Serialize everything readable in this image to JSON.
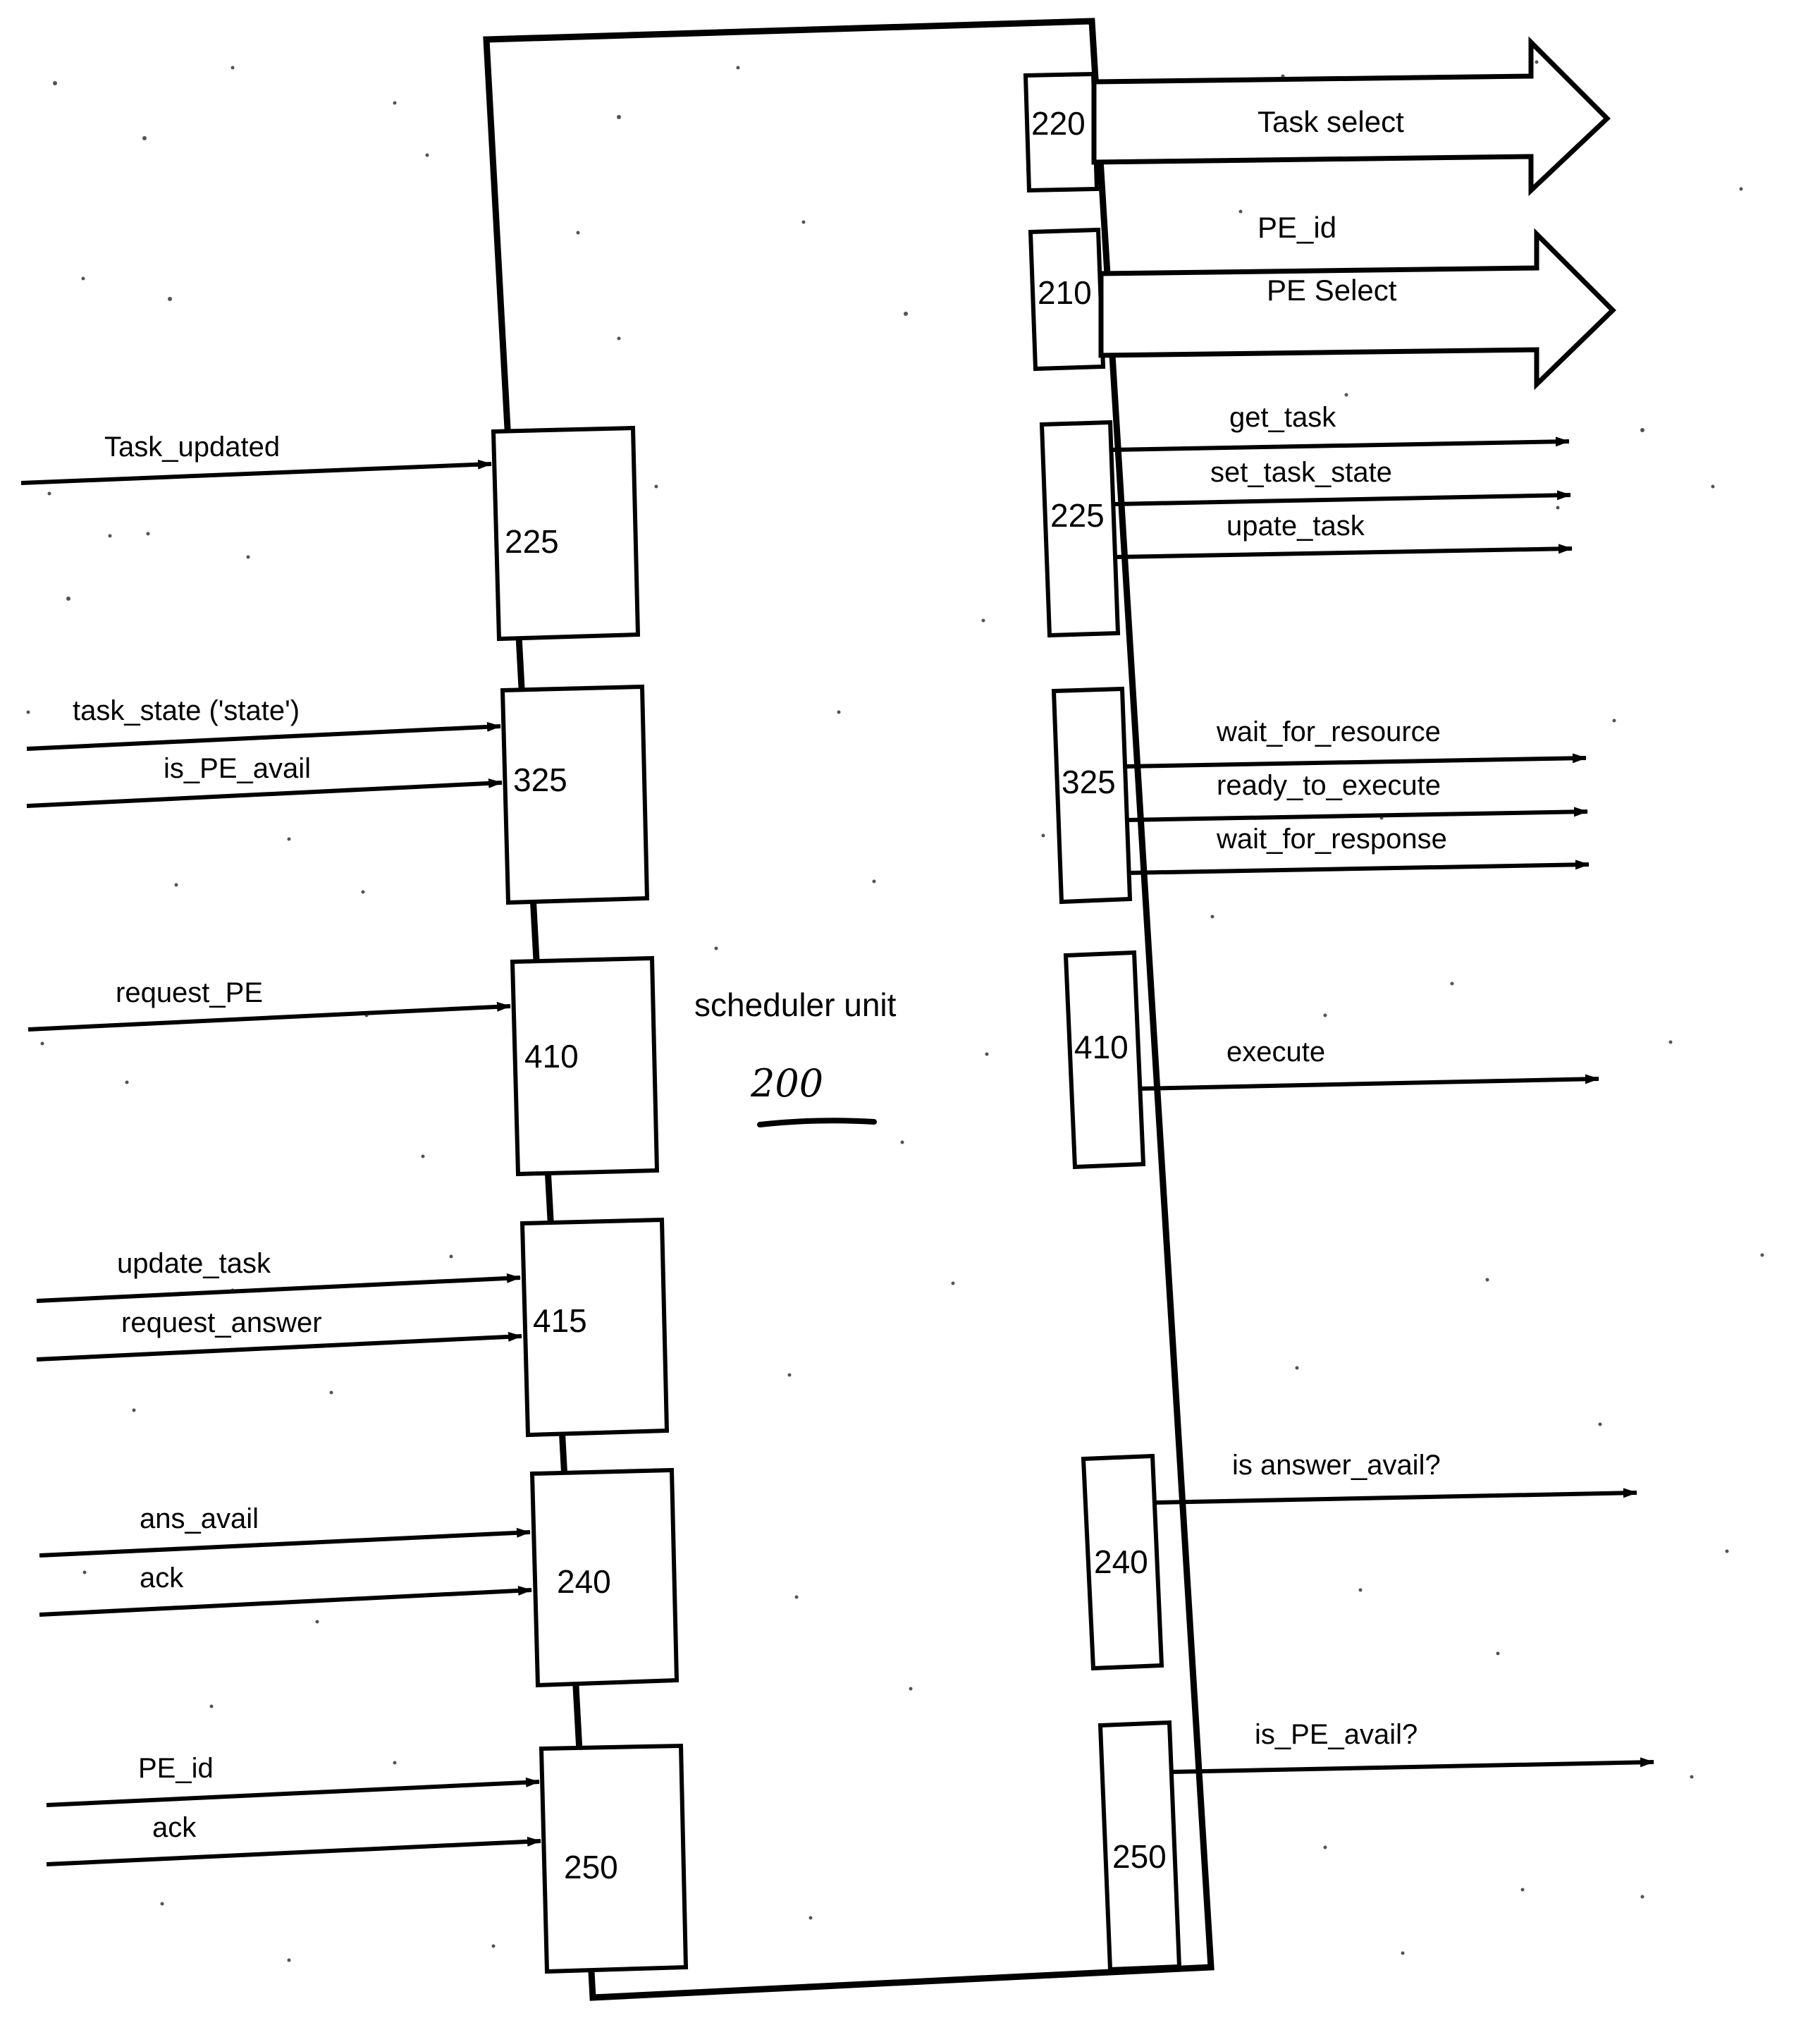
{
  "diagram": {
    "title": "scheduler unit",
    "reference_number": "200",
    "ink_color": "#000000",
    "background_color": "#ffffff"
  },
  "unit": {
    "label": "scheduler unit",
    "number": "200"
  },
  "left_ports": [
    {
      "number": "225",
      "signals": [
        "Task_updated"
      ]
    },
    {
      "number": "325",
      "signals": [
        "task_state ('state')",
        "is_PE_avail"
      ]
    },
    {
      "number": "410",
      "signals": [
        "request_PE"
      ]
    },
    {
      "number": "415",
      "signals": [
        "update_task",
        "request_answer"
      ]
    },
    {
      "number": "240",
      "signals": [
        "ans_avail",
        "ack"
      ]
    },
    {
      "number": "250",
      "signals": [
        "PE_id",
        "ack"
      ]
    }
  ],
  "right_ports": [
    {
      "number": "220",
      "style": "block-arrow",
      "inner_label": "Task select",
      "above_label": "",
      "signals": []
    },
    {
      "number": "210",
      "style": "block-arrow",
      "inner_label": "PE Select",
      "above_label": "PE_id",
      "signals": []
    },
    {
      "number": "225",
      "style": "line-arrows",
      "signals": [
        "get_task",
        "set_task_state",
        "upate_task"
      ]
    },
    {
      "number": "325",
      "style": "line-arrows",
      "signals": [
        "wait_for_resource",
        "ready_to_execute",
        "wait_for_response"
      ]
    },
    {
      "number": "410",
      "style": "line-arrows",
      "signals": [
        "execute"
      ]
    },
    {
      "number": "240",
      "style": "line-arrows",
      "signals": [
        "is answer_avail?"
      ]
    },
    {
      "number": "250",
      "style": "line-arrows",
      "signals": [
        "is_PE_avail?"
      ]
    }
  ],
  "text": {
    "task_updated": "Task_updated",
    "task_state": "task_state ('state')",
    "is_PE_avail_in": "is_PE_avail",
    "request_PE": "request_PE",
    "update_task_in": "update_task",
    "request_answer": "request_answer",
    "ans_avail": "ans_avail",
    "ack_240": "ack",
    "PE_id_in": "PE_id",
    "ack_250": "ack",
    "task_select": "Task select",
    "pe_id_out": "PE_id",
    "pe_select": "PE Select",
    "get_task": "get_task",
    "set_task_state": "set_task_state",
    "upate_task": "upate_task",
    "wait_for_resource": "wait_for_resource",
    "ready_to_execute": "ready_to_execute",
    "wait_for_response": "wait_for_response",
    "execute": "execute",
    "is_answer_avail": "is answer_avail?",
    "is_PE_avail_out": "is_PE_avail?",
    "num_L225": "225",
    "num_L325": "325",
    "num_L410": "410",
    "num_L415": "415",
    "num_L240": "240",
    "num_L250": "250",
    "num_R220": "220",
    "num_R210": "210",
    "num_R225": "225",
    "num_R325": "325",
    "num_R410": "410",
    "num_R240": "240",
    "num_R250": "250",
    "unit_label": "scheduler unit",
    "unit_number": "200"
  }
}
